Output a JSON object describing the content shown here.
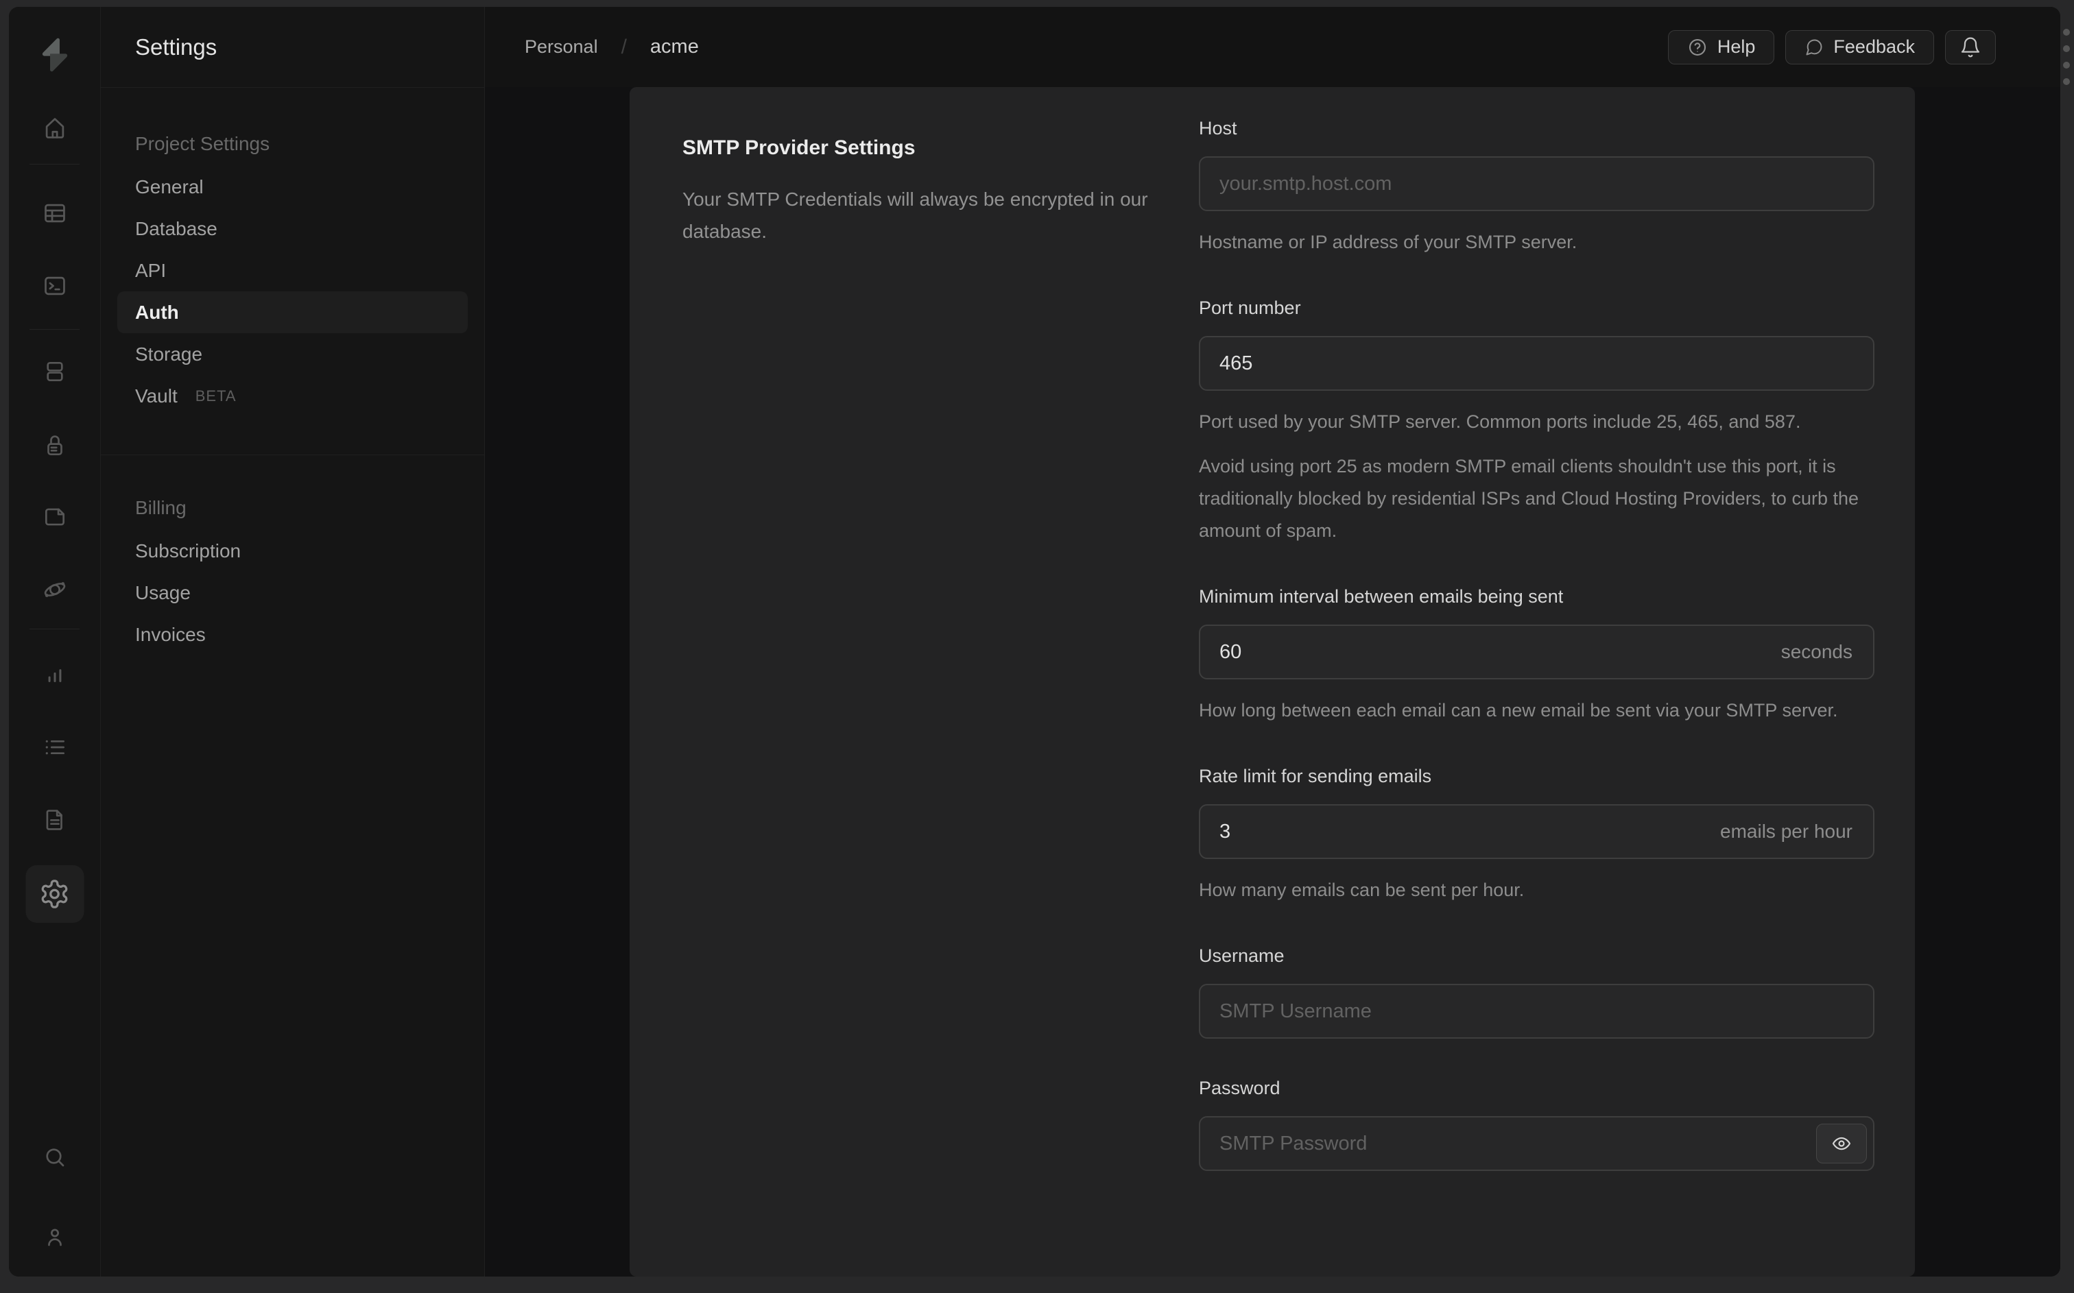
{
  "colors": {
    "card_bg": "#232324",
    "window_bg": "#131313",
    "sidebar_bg": "#151515"
  },
  "rail": {
    "icons": [
      "supabase-logo",
      "home",
      "table-editor",
      "sql-editor",
      "database",
      "auth",
      "storage",
      "edge-functions",
      "reports",
      "logs",
      "docs",
      "project-settings-gear",
      "search",
      "account"
    ]
  },
  "sidebar": {
    "title": "Settings",
    "sections": [
      {
        "header": "Project Settings",
        "items": [
          {
            "label": "General"
          },
          {
            "label": "Database"
          },
          {
            "label": "API"
          },
          {
            "label": "Auth"
          },
          {
            "label": "Storage"
          },
          {
            "label": "Vault",
            "badge": "BETA"
          }
        ]
      },
      {
        "header": "Billing",
        "items": [
          {
            "label": "Subscription"
          },
          {
            "label": "Usage"
          },
          {
            "label": "Invoices"
          }
        ]
      }
    ]
  },
  "header": {
    "breadcrumb": {
      "org": "Personal",
      "separator": "/",
      "project": "acme"
    },
    "help_label": "Help",
    "feedback_label": "Feedback"
  },
  "panel": {
    "title": "SMTP Provider Settings",
    "description": "Your SMTP Credentials will always be encrypted in our database.",
    "fields": {
      "host": {
        "label": "Host",
        "placeholder": "your.smtp.host.com",
        "helper": "Hostname or IP address of your SMTP server."
      },
      "port": {
        "label": "Port number",
        "value": "465",
        "helper": "Port used by your SMTP server. Common ports include 25, 465, and 587.",
        "warning": "Avoid using port 25 as modern SMTP email clients shouldn't use this port, it is traditionally blocked by residential ISPs and Cloud Hosting Providers, to curb the amount of spam."
      },
      "interval": {
        "label": "Minimum interval between emails being sent",
        "value": "60",
        "suffix": "seconds",
        "helper": "How long between each email can a new email be sent via your SMTP server."
      },
      "rate": {
        "label": "Rate limit for sending emails",
        "value": "3",
        "suffix": "emails per hour",
        "helper": "How many emails can be sent per hour."
      },
      "username": {
        "label": "Username",
        "placeholder": "SMTP Username"
      },
      "password": {
        "label": "Password",
        "placeholder": "SMTP Password"
      }
    }
  }
}
